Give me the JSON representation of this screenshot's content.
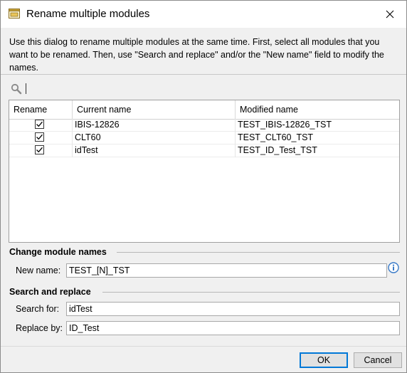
{
  "window": {
    "title": "Rename multiple modules",
    "icon": "dialog-window-icon",
    "close_icon": "close-icon"
  },
  "description": "Use this dialog to rename multiple modules at the same time. First, select all modules that you want to be renamed. Then, use \"Search and replace\" and/or the \"New name\" field to modify the names.",
  "filter": {
    "icon": "search-icon",
    "value": ""
  },
  "grid": {
    "columns": [
      "Rename",
      "Current name",
      "Modified name"
    ],
    "rows": [
      {
        "checked": true,
        "current": "IBIS-12826",
        "modified": "TEST_IBIS-12826_TST"
      },
      {
        "checked": true,
        "current": "CLT60",
        "modified": "TEST_CLT60_TST"
      },
      {
        "checked": true,
        "current": "idTest",
        "modified": "TEST_ID_Test_TST"
      }
    ]
  },
  "change_names": {
    "title": "Change module names",
    "new_name_label": "New name:",
    "new_name_value": "TEST_[N]_TST",
    "info_icon": "info-icon"
  },
  "search_replace": {
    "title": "Search and replace",
    "search_label": "Search for:",
    "search_value": "idTest",
    "replace_label": "Replace by:",
    "replace_value": "ID_Test"
  },
  "buttons": {
    "ok": "OK",
    "cancel": "Cancel"
  },
  "colors": {
    "accent": "#0078d7",
    "info_blue": "#3a7bc8"
  }
}
